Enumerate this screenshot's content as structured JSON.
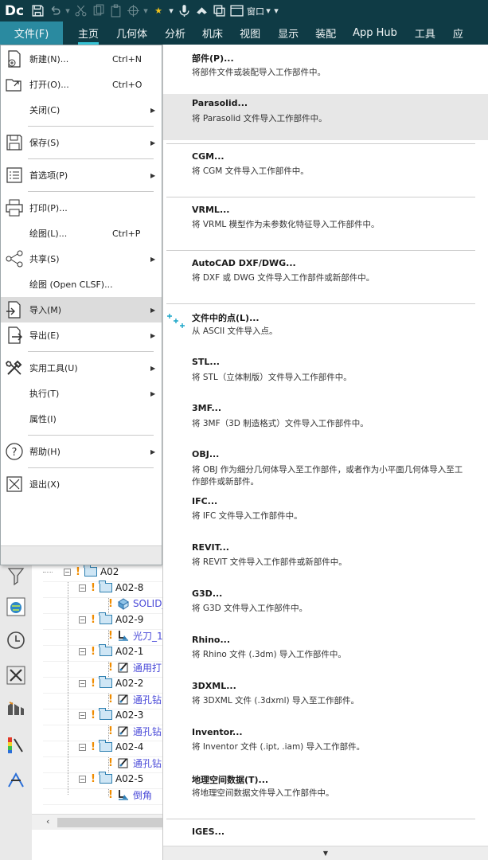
{
  "app": {
    "logo": "Dc",
    "window_label": "窗口"
  },
  "menubar": {
    "items": [
      "文件(F)",
      "主页",
      "几何体",
      "分析",
      "机床",
      "视图",
      "显示",
      "装配",
      "App Hub",
      "工具",
      "应"
    ],
    "active": "主页"
  },
  "file_menu": {
    "items": [
      {
        "label": "新建(N)...",
        "shortcut": "Ctrl+N",
        "icon": "new-file-icon"
      },
      {
        "label": "打开(O)...",
        "shortcut": "Ctrl+O",
        "icon": "open-folder-icon"
      },
      {
        "label": "关闭(C)",
        "submenu": true
      },
      {
        "label": "保存(S)",
        "submenu": true,
        "icon": "save-icon"
      },
      {
        "label": "首选项(P)",
        "submenu": true,
        "icon": "preferences-icon"
      },
      {
        "label": "打印(P)...",
        "icon": "print-icon"
      },
      {
        "label": "绘图(L)...",
        "shortcut": "Ctrl+P"
      },
      {
        "label": "共享(S)",
        "submenu": true,
        "icon": "share-icon"
      },
      {
        "label": "绘图 (Open CLSF)..."
      },
      {
        "label": "导入(M)",
        "submenu": true,
        "icon": "import-icon",
        "highlighted": true
      },
      {
        "label": "导出(E)",
        "submenu": true,
        "icon": "export-icon"
      },
      {
        "label": "实用工具(U)",
        "submenu": true,
        "icon": "utilities-icon"
      },
      {
        "label": "执行(T)",
        "submenu": true
      },
      {
        "label": "属性(I)"
      },
      {
        "label": "帮助(H)",
        "submenu": true,
        "icon": "help-icon"
      },
      {
        "label": "退出(X)",
        "icon": "exit-icon"
      }
    ]
  },
  "import_menu": {
    "items": [
      {
        "title": "部件(P)...",
        "desc": "将部件文件或装配导入工作部件中。"
      },
      {
        "title": "Parasolid...",
        "desc": "将 Parasolid 文件导入工作部件中。",
        "highlighted": true
      },
      {
        "title": "CGM...",
        "desc": "将 CGM 文件导入工作部件中。"
      },
      {
        "title": "VRML...",
        "desc": "将 VRML 模型作为未参数化特征导入工作部件中。"
      },
      {
        "title": "AutoCAD DXF/DWG...",
        "desc": "将 DXF 或 DWG 文件导入工作部件或新部件中。"
      },
      {
        "title": "文件中的点(L)...",
        "desc": "从 ASCII 文件导入点。",
        "icon": "points-icon"
      },
      {
        "title": "STL...",
        "desc": "将 STL（立体制版）文件导入工作部件中。"
      },
      {
        "title": "3MF...",
        "desc": "将 3MF（3D 制造格式）文件导入工作部件中。"
      },
      {
        "title": "OBJ...",
        "desc": "将 OBJ 作为细分几何体导入至工作部件，或者作为小平面几何体导入至工作部件或新部件。"
      },
      {
        "title": "IFC...",
        "desc": "将 IFC 文件导入工作部件中。"
      },
      {
        "title": "REVIT...",
        "desc": "将 REVIT 文件导入工作部件或新部件中。"
      },
      {
        "title": "G3D...",
        "desc": "将 G3D 文件导入工作部件中。"
      },
      {
        "title": "Rhino...",
        "desc": "将 Rhino 文件 (.3dm) 导入工作部件中。"
      },
      {
        "title": "3DXML...",
        "desc": "将 3DXML 文件 (.3dxml) 导入至工作部件。"
      },
      {
        "title": "Inventor...",
        "desc": "将 Inventor 文件 (.ipt, .iam) 导入工作部件。"
      },
      {
        "title": "地理空间数据(T)...",
        "desc": "将地理空间数据文件导入工作部件中。"
      },
      {
        "title": "IGES...",
        "desc": ""
      }
    ]
  },
  "tree": {
    "nodes": [
      {
        "label": "A02",
        "kind": "folder"
      },
      {
        "label": "A02-8",
        "kind": "folder"
      },
      {
        "label": "SOLID_",
        "kind": "feature",
        "icon": "solid-icon"
      },
      {
        "label": "A02-9",
        "kind": "folder"
      },
      {
        "label": "光刀_1",
        "kind": "feature",
        "icon": "finish-cut-icon"
      },
      {
        "label": "A02-1",
        "kind": "folder"
      },
      {
        "label": "通用打",
        "kind": "feature",
        "icon": "drill-icon"
      },
      {
        "label": "A02-2",
        "kind": "folder"
      },
      {
        "label": "通孔钻",
        "kind": "feature",
        "icon": "drill-icon"
      },
      {
        "label": "A02-3",
        "kind": "folder"
      },
      {
        "label": "通孔钻",
        "kind": "feature",
        "icon": "drill-icon"
      },
      {
        "label": "A02-4",
        "kind": "folder"
      },
      {
        "label": "通孔钻",
        "kind": "feature",
        "icon": "drill-icon"
      },
      {
        "label": "A02-5",
        "kind": "folder"
      },
      {
        "label": "倒角",
        "kind": "feature",
        "icon": "finish-cut-icon"
      }
    ]
  },
  "colors": {
    "titlebar": "#0f3b45",
    "file_tab": "#2a8aa0",
    "active_underline": "#36c6d8",
    "tree_feature_text": "#4a4ad8"
  }
}
